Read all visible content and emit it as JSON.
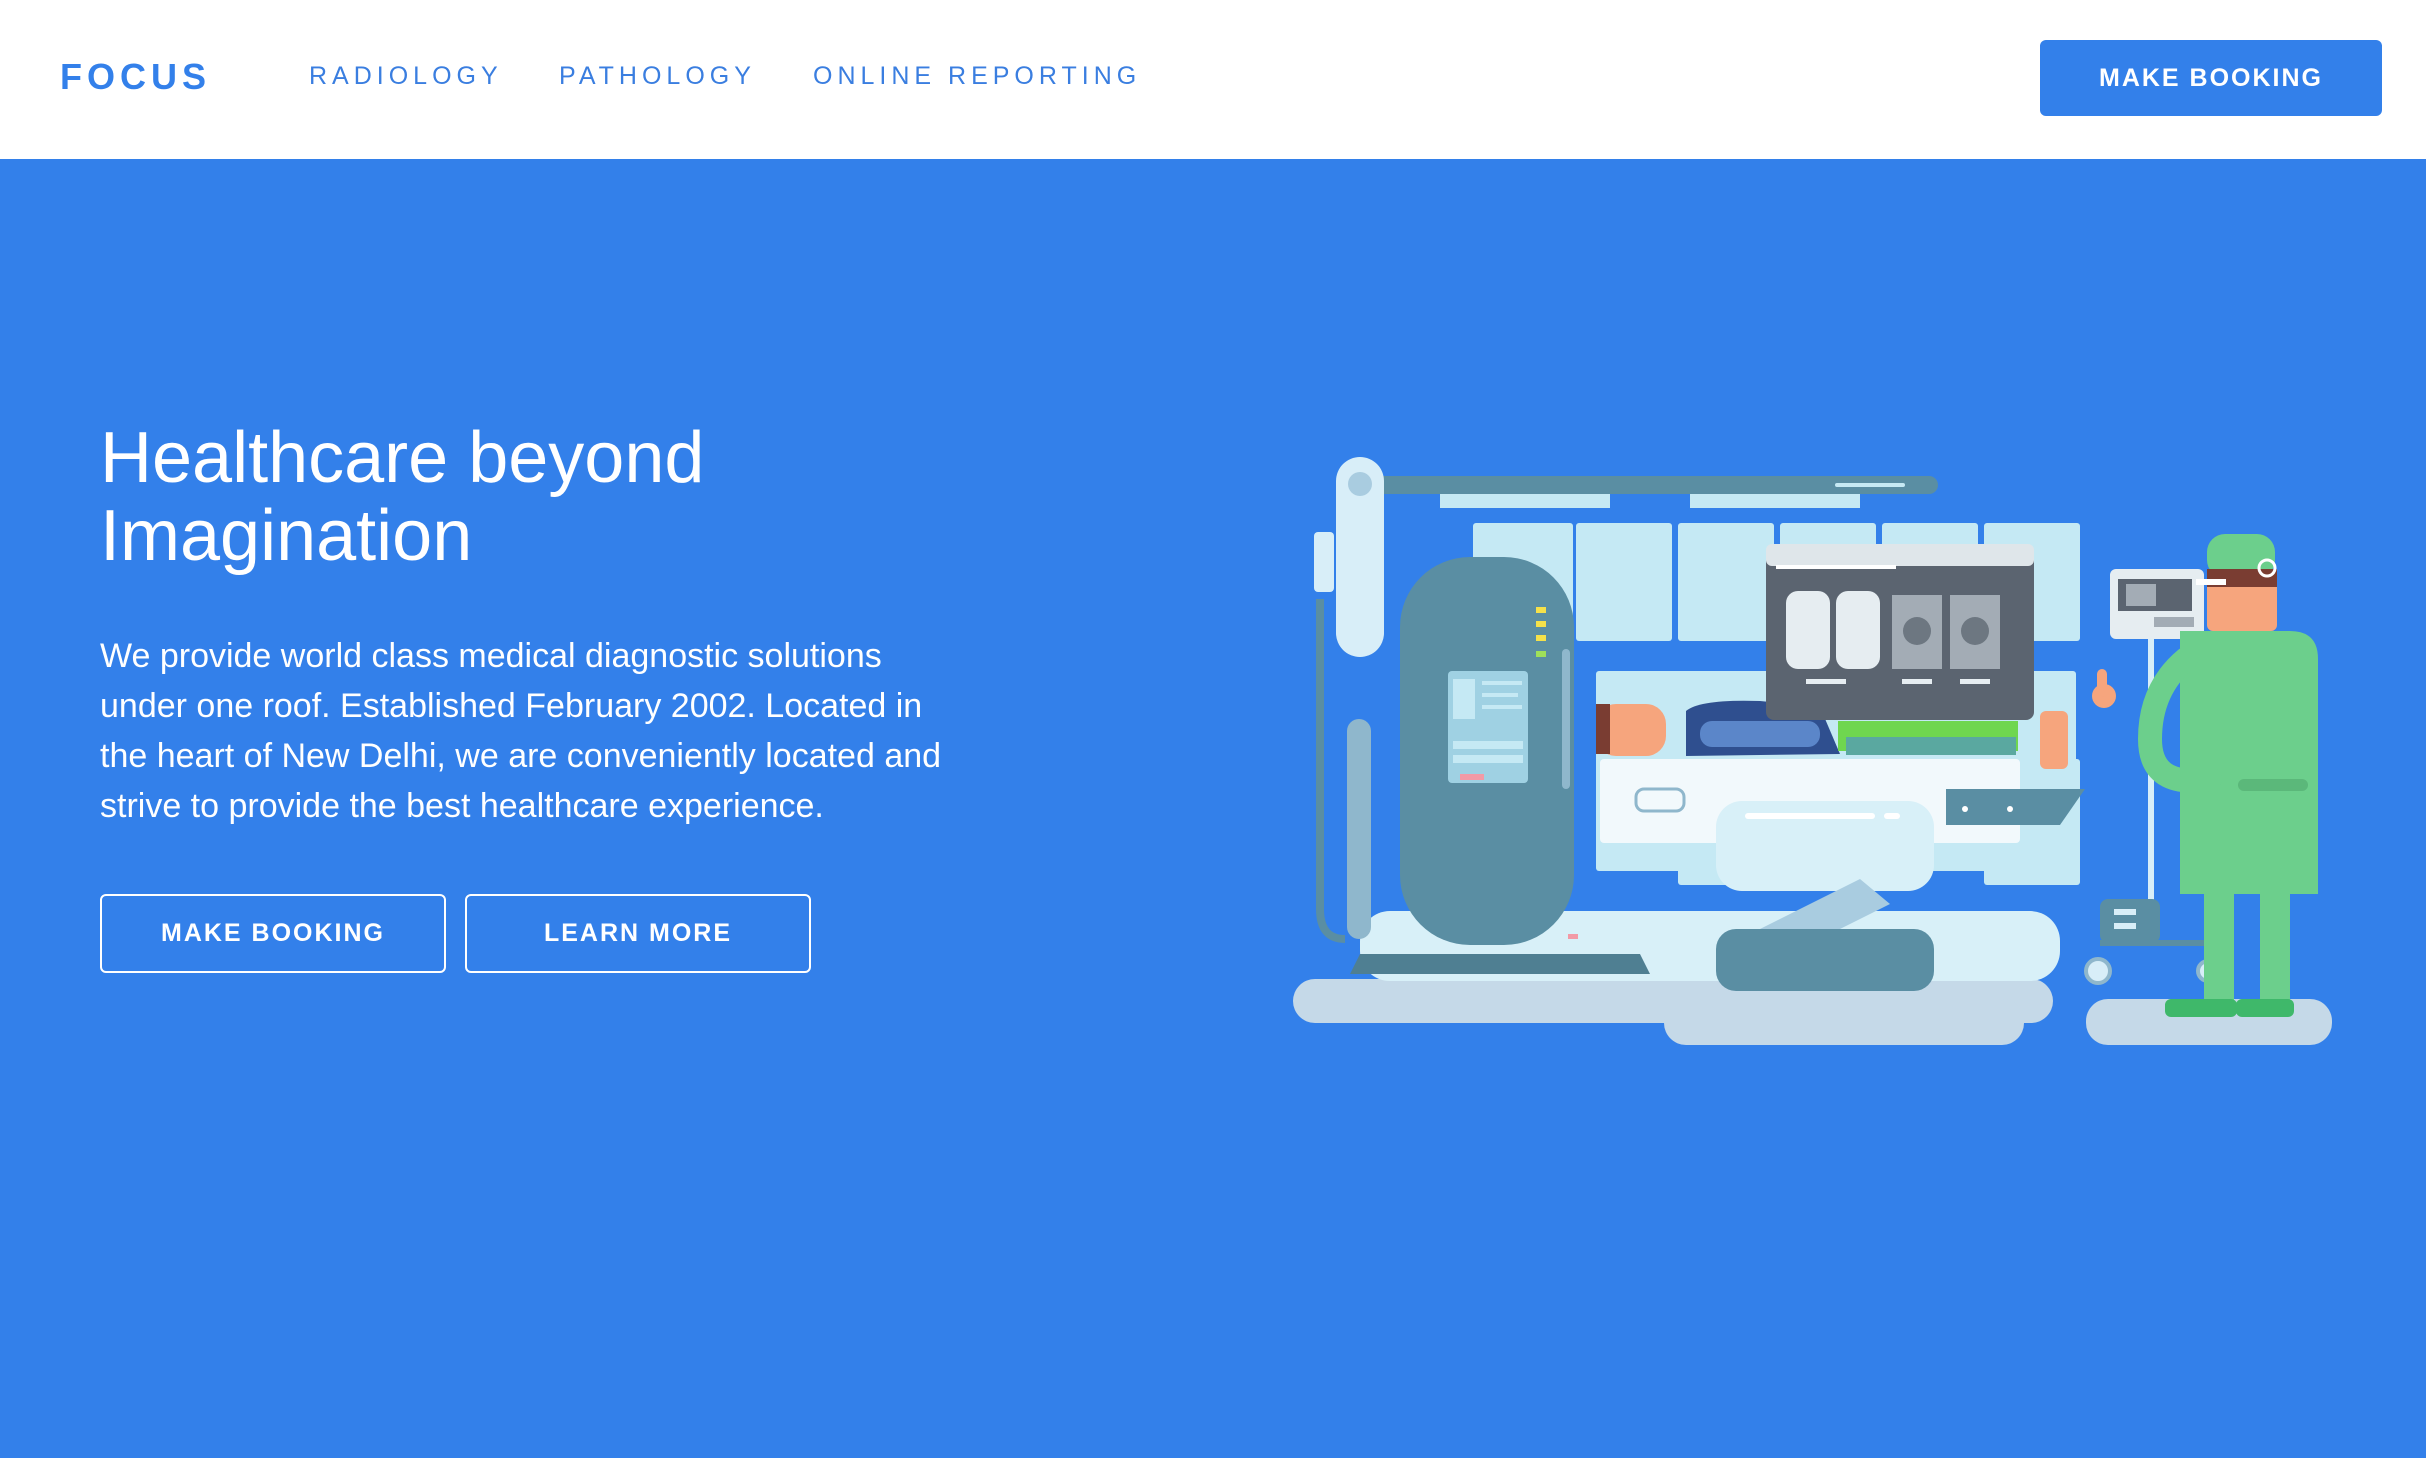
{
  "brand": {
    "logo_text": "FOCUS"
  },
  "nav": {
    "items": [
      {
        "label": "RADIOLOGY"
      },
      {
        "label": "PATHOLOGY"
      },
      {
        "label": "ONLINE REPORTING"
      }
    ],
    "cta_label": "MAKE BOOKING"
  },
  "hero": {
    "title_line1": "Healthcare beyond",
    "title_line2": "Imagination",
    "description_lines": [
      "We provide world class medical diagnostic solutions",
      "under one roof. Established February 2002. Located in",
      "the heart of New Delhi, we are conveniently located and",
      "strive to provide the best healthcare experience."
    ],
    "primary_button": "MAKE BOOKING",
    "secondary_button": "LEARN MORE"
  },
  "colors": {
    "brand_blue": "#3380ea",
    "white": "#ffffff",
    "machine_teal": "#5a8ea3",
    "panel_light": "#c5e9f4",
    "doctor_green": "#6ccf8c"
  }
}
